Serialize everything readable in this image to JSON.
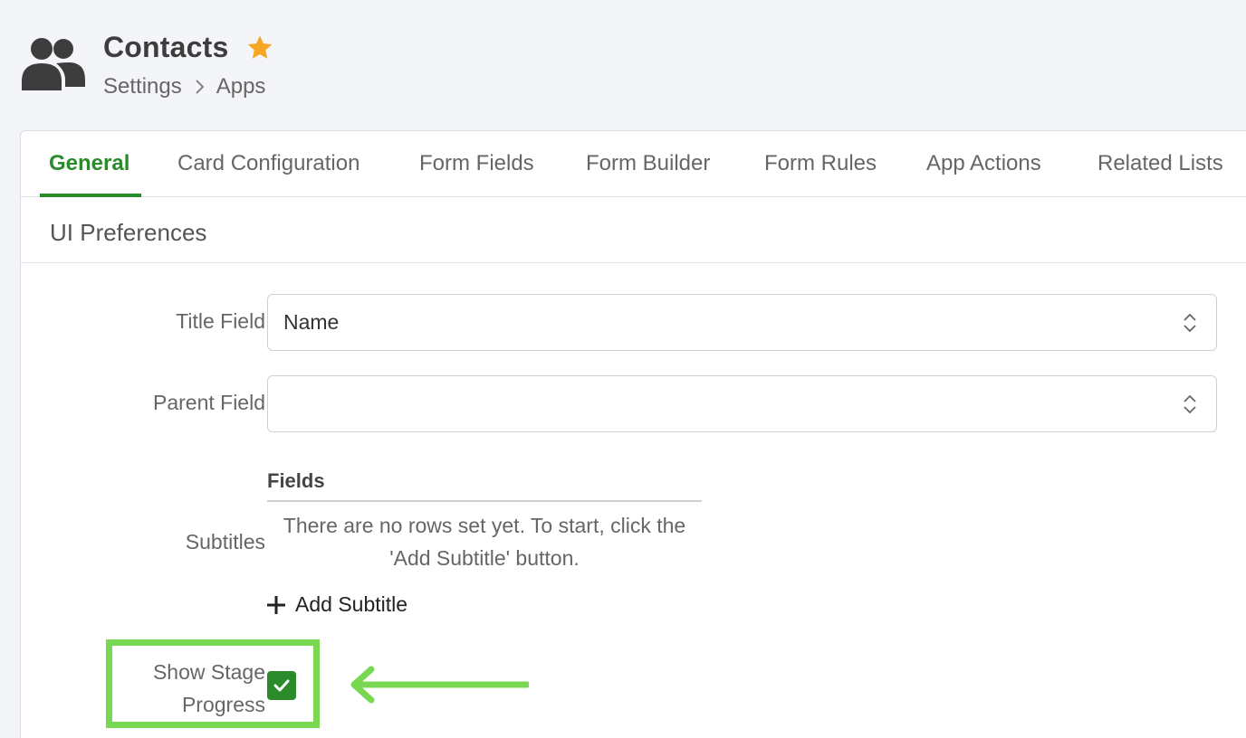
{
  "header": {
    "app_icon": "contacts-people-icon",
    "title": "Contacts",
    "favorite_icon": "star-icon",
    "favorite_color": "#f5a623",
    "breadcrumb": [
      "Settings",
      "Apps"
    ]
  },
  "tabs": [
    {
      "label": "General",
      "active": true
    },
    {
      "label": "Card Configuration",
      "active": false
    },
    {
      "label": "Form Fields",
      "active": false
    },
    {
      "label": "Form Builder",
      "active": false
    },
    {
      "label": "Form Rules",
      "active": false
    },
    {
      "label": "App Actions",
      "active": false
    },
    {
      "label": "Related Lists",
      "active": false
    }
  ],
  "section": {
    "title": "UI Preferences"
  },
  "form": {
    "title_field": {
      "label": "Title Field",
      "value": "Name"
    },
    "parent_field": {
      "label": "Parent Field",
      "value": ""
    },
    "subtitles": {
      "label": "Subtitles",
      "column_header": "Fields",
      "empty_message": "There are no rows set yet. To start, click the 'Add Subtitle' button.",
      "add_button_label": "Add Subtitle"
    },
    "show_stage_progress": {
      "label_line1": "Show Stage",
      "label_line2": "Progress",
      "checked": true
    }
  },
  "colors": {
    "accent": "#2b8a2b",
    "callout": "#79d851"
  }
}
